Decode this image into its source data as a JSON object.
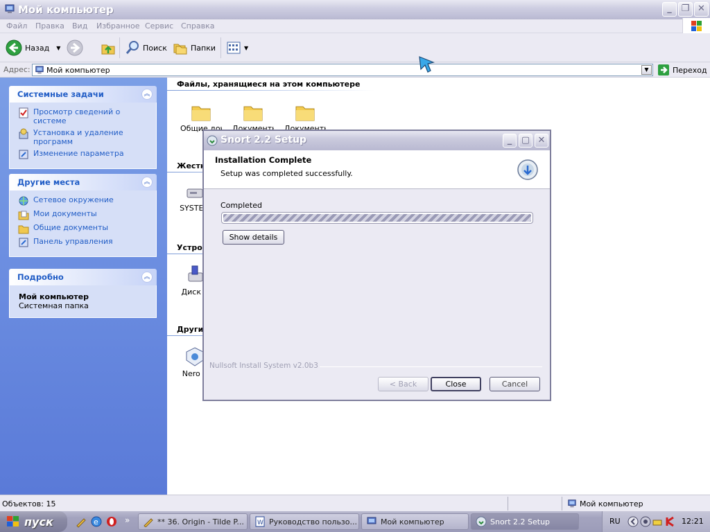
{
  "explorer": {
    "title": "Мой компьютер",
    "menu": [
      "Файл",
      "Правка",
      "Вид",
      "Избранное",
      "Сервис",
      "Справка"
    ],
    "toolbar": {
      "back": "Назад",
      "search": "Поиск",
      "folders": "Папки"
    },
    "address": {
      "label": "Адрес:",
      "value": "Мой компьютер",
      "go": "Переход"
    }
  },
  "taskpane": {
    "system_tasks": {
      "title": "Системные задачи",
      "items": [
        "Просмотр сведений о системе",
        "Установка и удаление программ",
        "Изменение параметра"
      ]
    },
    "other_places": {
      "title": "Другие места",
      "items": [
        "Сетевое окружение",
        "Мои документы",
        "Общие документы",
        "Панель управления"
      ]
    },
    "details": {
      "title": "Подробно",
      "name": "Мой компьютер",
      "desc": "Системная папка"
    }
  },
  "content": {
    "group_files": "Файлы, хранящиеся на этом компьютере",
    "group_hdd": "Жестк",
    "group_devices": "Устро",
    "group_other": "Други",
    "folders": [
      "Общие доку",
      "Документы",
      "Документы"
    ],
    "hdd_label": "SYSTEM",
    "disk_label": "Диск 3",
    "nero_label": "Nero S"
  },
  "statusbar": {
    "objects": "Объектов: 15",
    "location": "Мой компьютер"
  },
  "dialog": {
    "title": "Snort 2.2 Setup",
    "heading": "Installation Complete",
    "subheading": "Setup was completed successfully.",
    "progress_label": "Completed",
    "progress": 1.0,
    "show_details": "Show details",
    "branding": "Nullsoft Install System v2.0b3",
    "back": "< Back",
    "close": "Close",
    "cancel": "Cancel"
  },
  "taskbar": {
    "start": "пуск",
    "tasks": [
      "** 36. Origin - Tilde P...",
      "Руководство пользо...",
      "Мой компьютер",
      "Snort 2.2 Setup"
    ],
    "lang": "RU",
    "clock": "12:21"
  }
}
